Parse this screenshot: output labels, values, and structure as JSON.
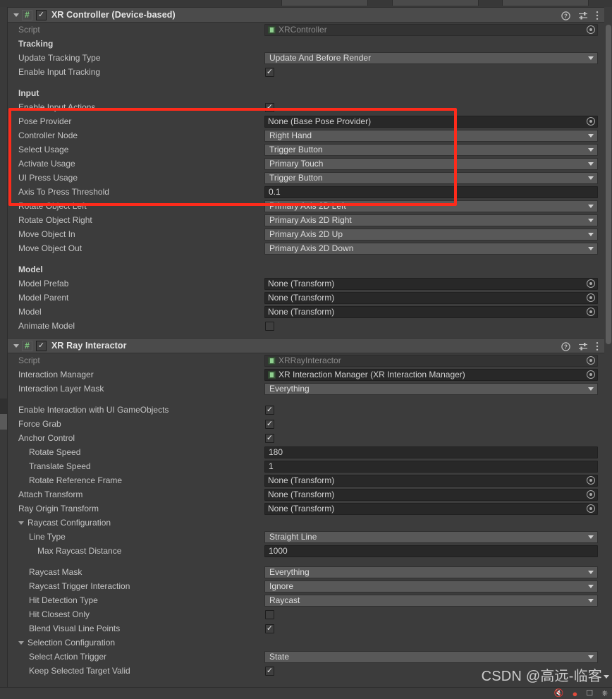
{
  "window": {
    "panel": "Inspector",
    "colors": {
      "panel_bg": "#3c3c3c",
      "header_bg": "#4b4b4b",
      "popup_bg": "#585858",
      "objfield_bg": "#282828",
      "label": "#c4c4c4",
      "annotation_red": "#fd2b1b",
      "script_green": "#7ec87e"
    }
  },
  "watermark": {
    "text": "CSDN @高远-临客"
  },
  "components": [
    {
      "title": "XR Controller (Device-based)",
      "enabled": true,
      "icons": {
        "help": "help-icon",
        "preset": "preset-icon",
        "menu": "more-menu-icon"
      },
      "rows": [
        {
          "kind": "object",
          "label": "Script",
          "value": "XRController",
          "disabled": true,
          "script_icon": true,
          "picker": true
        },
        {
          "kind": "header",
          "label": "Tracking"
        },
        {
          "kind": "popup",
          "label": "Update Tracking Type",
          "value": "Update And Before Render"
        },
        {
          "kind": "toggle",
          "label": "Enable Input Tracking",
          "checked": true
        },
        {
          "kind": "spacer"
        },
        {
          "kind": "header",
          "label": "Input"
        },
        {
          "kind": "toggle",
          "label": "Enable Input Actions",
          "checked": true
        },
        {
          "kind": "object",
          "label": "Pose Provider",
          "value": "None (Base Pose Provider)",
          "picker": true
        },
        {
          "kind": "popup",
          "label": "Controller Node",
          "value": "Right Hand"
        },
        {
          "kind": "popup",
          "label": "Select Usage",
          "value": "Trigger Button"
        },
        {
          "kind": "popup",
          "label": "Activate Usage",
          "value": "Primary Touch"
        },
        {
          "kind": "popup",
          "label": "UI Press Usage",
          "value": "Trigger Button"
        },
        {
          "kind": "number",
          "label": "Axis To Press Threshold",
          "value": "0.1"
        },
        {
          "kind": "popup",
          "label": "Rotate Object Left",
          "value": "Primary Axis 2D Left"
        },
        {
          "kind": "popup",
          "label": "Rotate Object Right",
          "value": "Primary Axis 2D Right"
        },
        {
          "kind": "popup",
          "label": "Move Object In",
          "value": "Primary Axis 2D Up"
        },
        {
          "kind": "popup",
          "label": "Move Object Out",
          "value": "Primary Axis 2D Down"
        },
        {
          "kind": "spacer"
        },
        {
          "kind": "header",
          "label": "Model"
        },
        {
          "kind": "object",
          "label": "Model Prefab",
          "value": "None (Transform)",
          "picker": true
        },
        {
          "kind": "object",
          "label": "Model Parent",
          "value": "None (Transform)",
          "picker": true
        },
        {
          "kind": "object",
          "label": "Model",
          "value": "None (Transform)",
          "picker": true
        },
        {
          "kind": "toggle",
          "label": "Animate Model",
          "checked": false
        }
      ]
    },
    {
      "title": "XR Ray Interactor",
      "enabled": true,
      "icons": {
        "help": "help-icon",
        "preset": "preset-icon",
        "menu": "more-menu-icon"
      },
      "rows": [
        {
          "kind": "object",
          "label": "Script",
          "value": "XRRayInteractor",
          "disabled": true,
          "script_icon": true,
          "picker": true
        },
        {
          "kind": "object",
          "label": "Interaction Manager",
          "value": "XR Interaction Manager (XR Interaction Manager)",
          "script_icon": true,
          "picker": true
        },
        {
          "kind": "popup",
          "label": "Interaction Layer Mask",
          "value": "Everything"
        },
        {
          "kind": "spacer"
        },
        {
          "kind": "toggle",
          "label": "Enable Interaction with UI GameObjects",
          "checked": true
        },
        {
          "kind": "toggle",
          "label": "Force Grab",
          "checked": true
        },
        {
          "kind": "toggle",
          "label": "Anchor Control",
          "checked": true
        },
        {
          "kind": "number",
          "label": "Rotate Speed",
          "value": "180",
          "indent": 1
        },
        {
          "kind": "number",
          "label": "Translate Speed",
          "value": "1",
          "indent": 1
        },
        {
          "kind": "object",
          "label": "Rotate Reference Frame",
          "value": "None (Transform)",
          "picker": true,
          "indent": 1
        },
        {
          "kind": "object",
          "label": "Attach Transform",
          "value": "None (Transform)",
          "picker": true
        },
        {
          "kind": "object",
          "label": "Ray Origin Transform",
          "value": "None (Transform)",
          "picker": true
        },
        {
          "kind": "foldout",
          "label": "Raycast Configuration"
        },
        {
          "kind": "popup",
          "label": "Line Type",
          "value": "Straight Line",
          "indent": 1
        },
        {
          "kind": "number",
          "label": "Max Raycast Distance",
          "value": "1000",
          "indent": 2
        },
        {
          "kind": "spacer"
        },
        {
          "kind": "popup",
          "label": "Raycast Mask",
          "value": "Everything",
          "indent": 1
        },
        {
          "kind": "popup",
          "label": "Raycast Trigger Interaction",
          "value": "Ignore",
          "indent": 1
        },
        {
          "kind": "popup",
          "label": "Hit Detection Type",
          "value": "Raycast",
          "indent": 1
        },
        {
          "kind": "toggle",
          "label": "Hit Closest Only",
          "checked": false,
          "indent": 1
        },
        {
          "kind": "toggle",
          "label": "Blend Visual Line Points",
          "checked": true,
          "indent": 1
        },
        {
          "kind": "foldout",
          "label": "Selection Configuration"
        },
        {
          "kind": "popup",
          "label": "Select Action Trigger",
          "value": "State",
          "indent": 1
        },
        {
          "kind": "toggle",
          "label": "Keep Selected Target Valid",
          "checked": true,
          "indent": 1
        }
      ]
    }
  ],
  "annotation": {
    "shape": "rectangle",
    "color": "#fd2b1b",
    "note": "Input usage settings highlight"
  },
  "status_bar_icons": [
    "mute-icon",
    "record-icon",
    "no-camera-icon",
    "audio-icon"
  ]
}
